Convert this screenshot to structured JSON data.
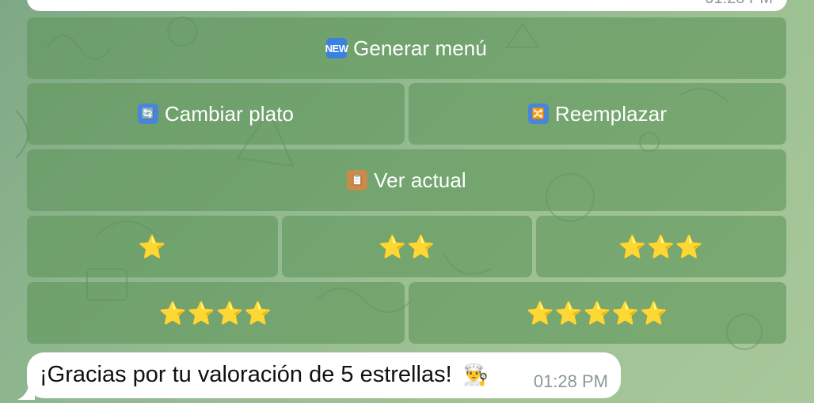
{
  "previous_message": {
    "time": "01:28 PM"
  },
  "keyboard": {
    "row1": {
      "icon": "new-icon",
      "icon_text": "NEW",
      "label": "Generar menú"
    },
    "row2": [
      {
        "icon": "refresh-icon",
        "icon_text": "🔄",
        "label": "Cambiar plato"
      },
      {
        "icon": "shuffle-icon",
        "icon_text": "🔀",
        "label": "Reemplazar"
      }
    ],
    "row3": {
      "icon": "clipboard-icon",
      "icon_text": "📋",
      "label": "Ver actual"
    },
    "row4": [
      {
        "label": "⭐"
      },
      {
        "label": "⭐⭐"
      },
      {
        "label": "⭐⭐⭐"
      }
    ],
    "row5": [
      {
        "label": "⭐⭐⭐⭐"
      },
      {
        "label": "⭐⭐⭐⭐⭐"
      }
    ]
  },
  "message": {
    "text": "¡Gracias por tu valoración de 5 estrellas!",
    "emoji": "👨‍🍳",
    "time": "01:28 PM"
  },
  "colors": {
    "background": "#8fb78f",
    "button_fill": "#60965a",
    "bubble": "#ffffff",
    "star": "#f7c631"
  }
}
